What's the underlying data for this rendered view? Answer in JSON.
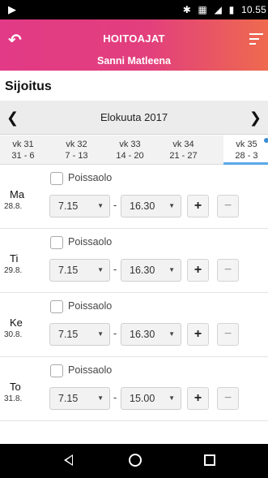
{
  "status_bar": {
    "left_icon": "notification-icon",
    "right_icons": [
      "bluetooth-icon",
      "vibrate-icon",
      "signal-4g-icon",
      "battery-icon"
    ],
    "time": "10.55"
  },
  "header": {
    "back_icon": "back-arrow-icon",
    "title": "HOITOAJAT",
    "menu_icon": "menu-icon",
    "subtitle": "Sanni Matleena",
    "gradient_start": "#e23a86",
    "gradient_end": "#ee6a4e"
  },
  "section_title": "Sijoitus",
  "calendar": {
    "prev_icon": "chevron-left-icon",
    "month": "Elokuuta 2017",
    "next_icon": "chevron-right-icon",
    "weeks": [
      {
        "week": "vk 31",
        "range": "31 - 6"
      },
      {
        "week": "vk 32",
        "range": "7 - 13"
      },
      {
        "week": "vk 33",
        "range": "14 - 20"
      },
      {
        "week": "vk 34",
        "range": "21 - 27"
      },
      {
        "week": "vk 35",
        "range": "28 - 3",
        "active": true
      }
    ],
    "active_color": "#5aa9e6"
  },
  "days": [
    {
      "name": "Ma",
      "date": "28.8.",
      "absence_label": "Poissaolo",
      "start": "7.15",
      "dash": "-",
      "end": "16.30",
      "plus": "+",
      "minus": "−"
    },
    {
      "name": "Ti",
      "date": "29.8.",
      "absence_label": "Poissaolo",
      "start": "7.15",
      "dash": "-",
      "end": "16.30",
      "plus": "+",
      "minus": "−"
    },
    {
      "name": "Ke",
      "date": "30.8.",
      "absence_label": "Poissaolo",
      "start": "7.15",
      "dash": "-",
      "end": "16.30",
      "plus": "+",
      "minus": "−"
    },
    {
      "name": "To",
      "date": "31.8.",
      "absence_label": "Poissaolo",
      "start": "7.15",
      "dash": "-",
      "end": "15.00",
      "plus": "+",
      "minus": "−"
    }
  ],
  "nav_bar": {
    "back": "nav-back-icon",
    "home": "nav-home-icon",
    "recent": "nav-recent-icon"
  }
}
